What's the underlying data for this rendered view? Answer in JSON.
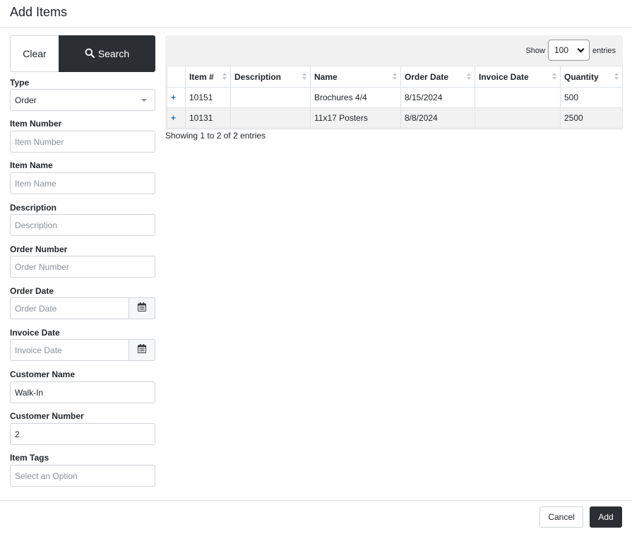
{
  "dialog": {
    "title": "Add Items"
  },
  "filters": {
    "clear_label": "Clear",
    "search_label": "Search",
    "type": {
      "label": "Type",
      "value": "Order"
    },
    "item_number": {
      "label": "Item Number",
      "placeholder": "Item Number"
    },
    "item_name": {
      "label": "Item Name",
      "placeholder": "Item Name"
    },
    "description": {
      "label": "Description",
      "placeholder": "Description"
    },
    "order_number": {
      "label": "Order Number",
      "placeholder": "Order Number"
    },
    "order_date": {
      "label": "Order Date",
      "placeholder": "Order Date"
    },
    "invoice_date": {
      "label": "Invoice Date",
      "placeholder": "Invoice Date"
    },
    "customer_name": {
      "label": "Customer Name",
      "value": "Walk-In"
    },
    "customer_number": {
      "label": "Customer Number",
      "value": "2"
    },
    "item_tags": {
      "label": "Item Tags",
      "placeholder": "Select an Option"
    }
  },
  "table": {
    "show_label": "Show",
    "page_size": "100",
    "entries_label": "entries",
    "columns": [
      "Item #",
      "Description",
      "Name",
      "Order Date",
      "Invoice Date",
      "Quantity"
    ],
    "rows": [
      {
        "expand": "+",
        "item": "10151",
        "description": "",
        "name": "Brochures 4/4",
        "order_date": "8/15/2024",
        "invoice_date": "",
        "quantity": "500"
      },
      {
        "expand": "+",
        "item": "10131",
        "description": "",
        "name": "11x17 Posters",
        "order_date": "8/8/2024",
        "invoice_date": "",
        "quantity": "2500"
      }
    ],
    "info": "Showing 1 to 2 of 2 entries"
  },
  "footer": {
    "cancel_label": "Cancel",
    "add_label": "Add"
  }
}
